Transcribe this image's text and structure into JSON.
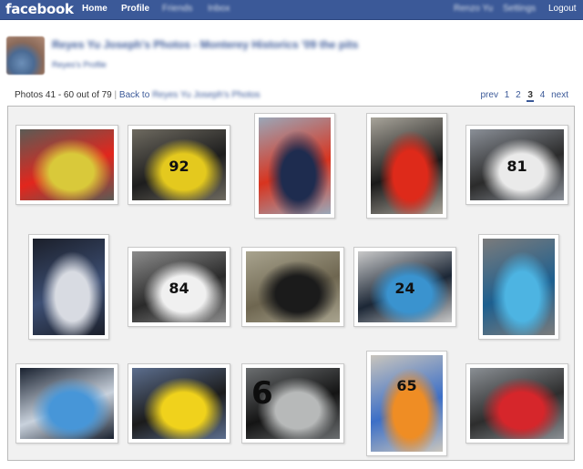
{
  "topbar": {
    "logo": "facebook",
    "home": "Home",
    "profile": "Profile",
    "friends": "Friends",
    "inbox": "Inbox",
    "user_name": "Renzo Yu",
    "settings": "Settings",
    "logout": "Logout"
  },
  "album": {
    "title": "Reyes Yu Joseph's Photos - Monterey Historics '09 the pits",
    "owner_link": "Reyes's Profile"
  },
  "paging": {
    "count_text": "Photos 41 - 60 out of 79",
    "separator": "|",
    "back_prefix": "Back to",
    "back_name": "Reyes Yu Joseph's Photos",
    "prev": "prev",
    "pages": [
      "1",
      "2",
      "3",
      "4"
    ],
    "current_page": "3",
    "next": "next"
  },
  "photos": [
    {
      "car": "yellow-red-ferraris",
      "colors": [
        "#d9c93a",
        "#e2261d",
        "#5b5b55"
      ]
    },
    {
      "car": "yellow-ferrari-92",
      "colors": [
        "#e4c91e",
        "#1d1d1d",
        "#6e6a60"
      ],
      "number": "92"
    },
    {
      "car": "blue-racer-red-stripe",
      "colors": [
        "#1e2c4f",
        "#d8341f",
        "#9aa7b8"
      ]
    },
    {
      "car": "red-black-stripes",
      "colors": [
        "#de2a1a",
        "#1a1a1a",
        "#a8a49a"
      ]
    },
    {
      "car": "white-racer-81",
      "colors": [
        "#eaeaea",
        "#2b2b2b",
        "#8a8f97"
      ],
      "number": "81"
    },
    {
      "car": "silver-blue-cockpit",
      "colors": [
        "#d8dbe2",
        "#3d4f74",
        "#1b1f2a"
      ]
    },
    {
      "car": "white-racer-84",
      "colors": [
        "#f0f0f0",
        "#2a2a2a",
        "#8c8c8c"
      ],
      "number": "84"
    },
    {
      "car": "black-alfa",
      "colors": [
        "#1b1b1b",
        "#6e6650",
        "#a9a48f"
      ]
    },
    {
      "car": "blue-racer-24",
      "colors": [
        "#3a93cf",
        "#1c2736",
        "#c9c9c9"
      ],
      "number": "24"
    },
    {
      "car": "blue-engine-racer",
      "colors": [
        "#4db4e2",
        "#1d5f8f",
        "#7b7b7b"
      ]
    },
    {
      "car": "blue-silver-closeup",
      "colors": [
        "#4796d8",
        "#c9d2dd",
        "#1a2230"
      ]
    },
    {
      "car": "yellow-dino",
      "colors": [
        "#f0d21c",
        "#1b1b1b",
        "#5c6e8e"
      ]
    },
    {
      "car": "silver-6",
      "colors": [
        "#b7b9b9",
        "#141414",
        "#6b6e70"
      ],
      "number": "6"
    },
    {
      "car": "orange-blue-65",
      "colors": [
        "#ef8d24",
        "#3c6fc7",
        "#c9c5bd"
      ],
      "number": "65"
    },
    {
      "car": "red-car-trailer",
      "colors": [
        "#d6262b",
        "#2d2d2d",
        "#8a8f94"
      ]
    }
  ]
}
